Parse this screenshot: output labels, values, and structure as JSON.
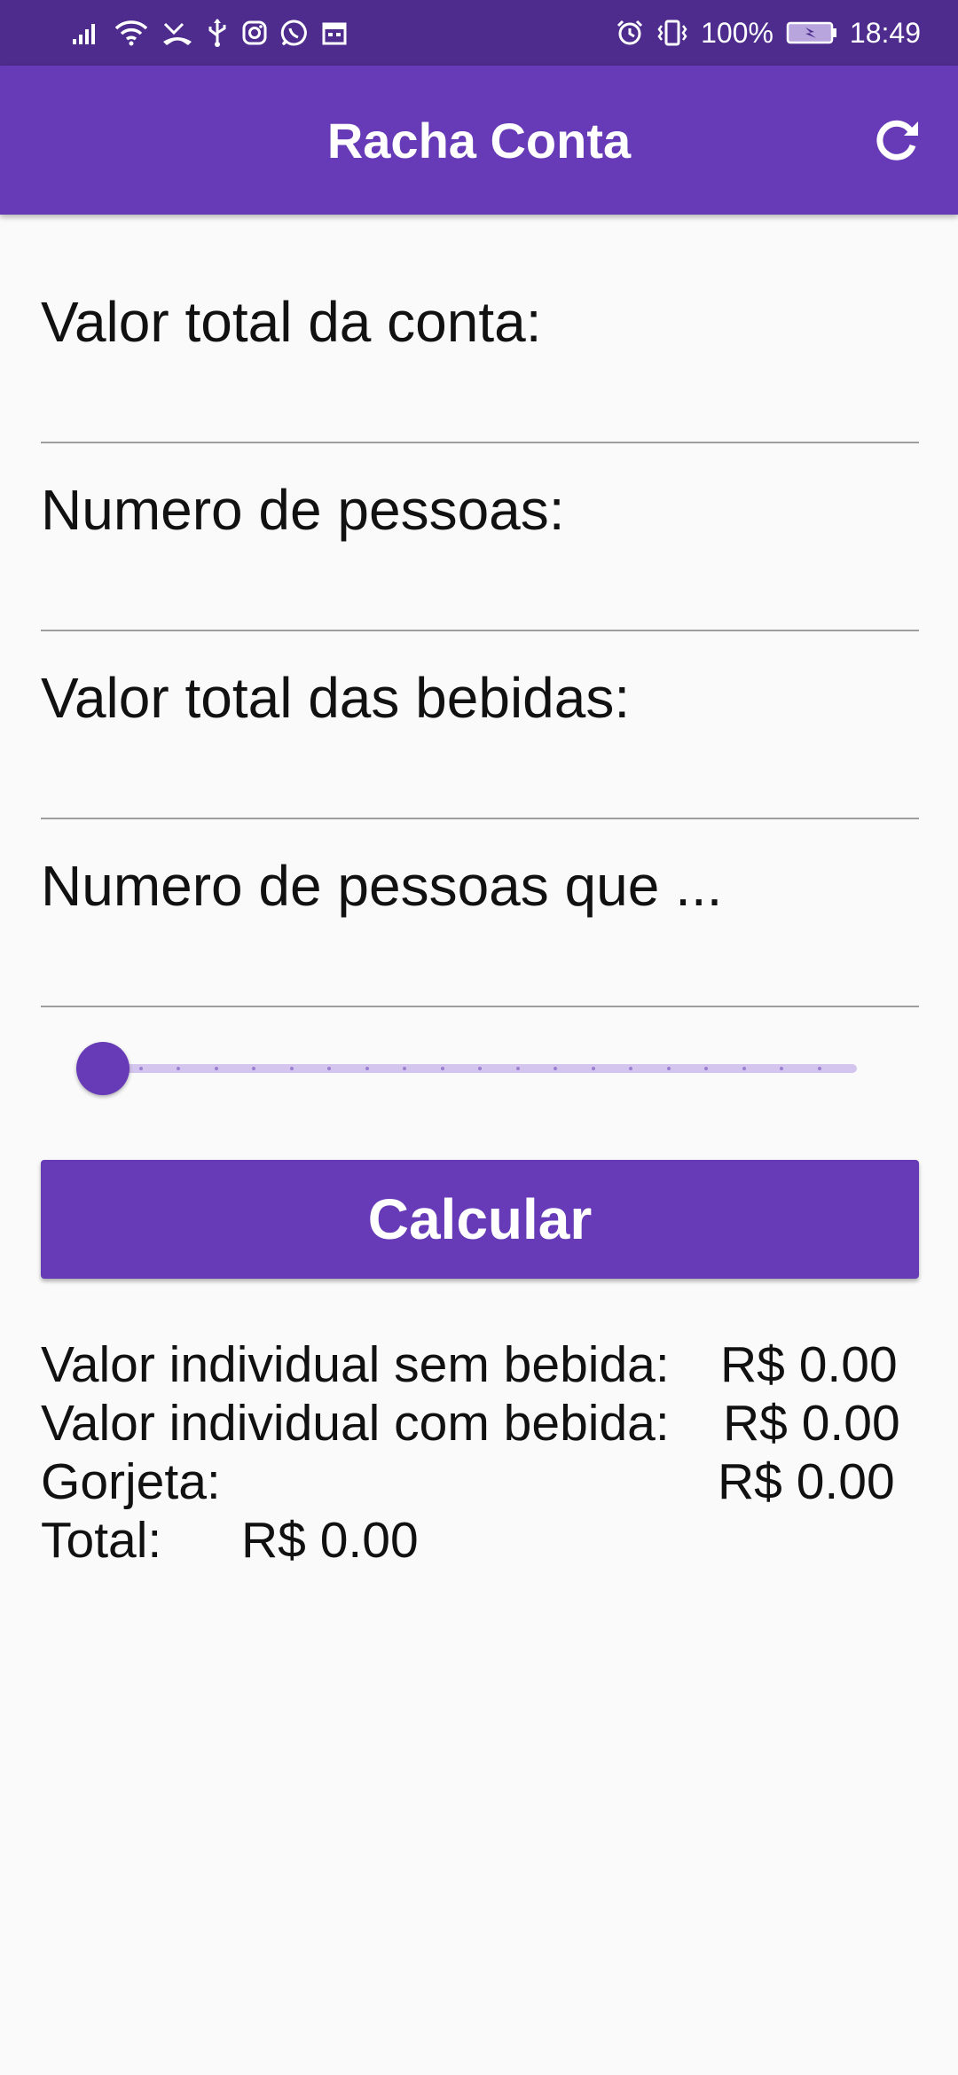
{
  "status_bar": {
    "battery": "100%",
    "time": "18:49",
    "left_icons": [
      "signal-icon",
      "wifi-icon",
      "missed-call-icon",
      "usb-icon",
      "instagram-icon",
      "whatsapp-icon",
      "calendar-icon"
    ],
    "right_icons": [
      "alarm-icon",
      "vibrate-icon",
      "battery-icon"
    ]
  },
  "app_bar": {
    "title": "Racha Conta",
    "action_icon": "refresh-icon"
  },
  "form": {
    "total_label": "Valor total da conta:",
    "people_label": "Numero de pessoas:",
    "drinks_label": "Valor total das bebidas:",
    "drinkers_label": "Numero de pessoas que ..."
  },
  "tip_slider": {
    "value": 0,
    "divisions": 20
  },
  "calc_button_label": "Calcular",
  "results": {
    "no_drink_label": "Valor individual sem bebida:",
    "no_drink_value": "R$ 0.00",
    "with_drink_label": "Valor individual com bebida:",
    "with_drink_value": "R$ 0.00",
    "tip_label": "Gorjeta:",
    "tip_value": "R$ 0.00",
    "total_label": "Total:",
    "total_value": "R$ 0.00"
  },
  "colors": {
    "primary": "#673ab7",
    "status_bar": "#4d2c8e",
    "slider_track": "#d4c5ee",
    "background": "#fafafa"
  }
}
